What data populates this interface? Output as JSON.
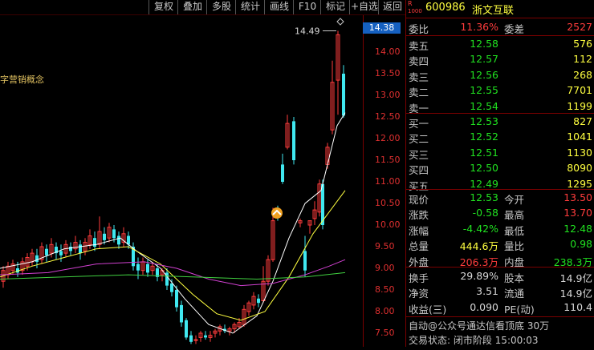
{
  "toolbar": {
    "buttons": [
      "复权",
      "叠加",
      "多股",
      "统计",
      "画线",
      "F10",
      "标记",
      "+自选",
      "返回"
    ]
  },
  "chart": {
    "concept_text": "字营销概念",
    "price_tag": "14.38",
    "high_label": "14.49",
    "ticks": [
      "14.00",
      "13.50",
      "13.00",
      "12.50",
      "12.00",
      "11.50",
      "11.00",
      "10.50",
      "10.00",
      "9.50",
      "9.00",
      "8.50",
      "8.00",
      "7.50"
    ]
  },
  "header": {
    "badge_r": "R",
    "badge_num": "1000",
    "code": "600986",
    "name": "浙文互联"
  },
  "ratio": {
    "label": "委比",
    "value": "11.36%",
    "label2": "委差",
    "value2": "2527"
  },
  "asks": [
    {
      "label": "卖五",
      "price": "12.58",
      "vol": "576"
    },
    {
      "label": "卖四",
      "price": "12.57",
      "vol": "112"
    },
    {
      "label": "卖三",
      "price": "12.56",
      "vol": "268"
    },
    {
      "label": "卖二",
      "price": "12.55",
      "vol": "7701"
    },
    {
      "label": "卖一",
      "price": "12.54",
      "vol": "1199"
    }
  ],
  "bids": [
    {
      "label": "买一",
      "price": "12.53",
      "vol": "827"
    },
    {
      "label": "买二",
      "price": "12.52",
      "vol": "1041"
    },
    {
      "label": "买三",
      "price": "12.51",
      "vol": "1130"
    },
    {
      "label": "买四",
      "price": "12.50",
      "vol": "8090"
    },
    {
      "label": "买五",
      "price": "12.49",
      "vol": "1295"
    }
  ],
  "stats": [
    {
      "l1": "现价",
      "v1": "12.53",
      "c1": "green",
      "l2": "今开",
      "v2": "13.50",
      "c2": "red"
    },
    {
      "l1": "涨跌",
      "v1": "-0.58",
      "c1": "green",
      "l2": "最高",
      "v2": "13.70",
      "c2": "red"
    },
    {
      "l1": "涨幅",
      "v1": "-4.42%",
      "c1": "green",
      "l2": "最低",
      "v2": "12.48",
      "c2": "green"
    },
    {
      "l1": "总量",
      "v1": "444.6万",
      "c1": "yellow",
      "l2": "量比",
      "v2": "0.98",
      "c2": "green"
    },
    {
      "l1": "外盘",
      "v1": "206.3万",
      "c1": "red",
      "l2": "内盘",
      "v2": "238.3万",
      "c2": "green"
    }
  ],
  "stats2": [
    {
      "l1": "换手",
      "v1": "29.89%",
      "c1": "white",
      "l2": "股本",
      "v2": "14.9亿",
      "c2": "white"
    },
    {
      "l1": "净资",
      "v1": "3.51",
      "c1": "white",
      "l2": "流通",
      "v2": "14.9亿",
      "c2": "white"
    },
    {
      "l1": "收益(三)",
      "v1": "0.090",
      "c1": "white",
      "l2": "PE(动)",
      "v2": "110.4",
      "c2": "white"
    }
  ],
  "footer": {
    "line1": "自动@公众号通达信看顶底 30万",
    "line2": "交易状态: 闭市阶段 15:00:03"
  },
  "colors": {
    "up": "#ff3c3c",
    "down": "#40e8f0",
    "ma5": "#ffffff",
    "ma10": "#ffff40",
    "ma20": "#d040d0",
    "ma60": "#40d040"
  }
}
